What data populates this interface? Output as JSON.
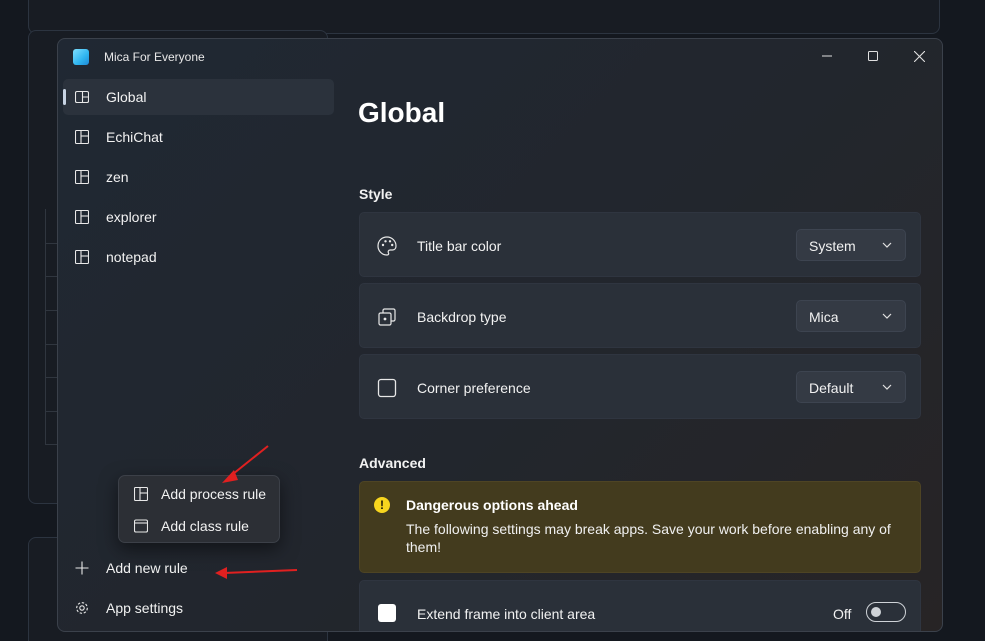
{
  "window": {
    "title": "Mica For Everyone"
  },
  "sidebar": {
    "items": [
      {
        "label": "Global",
        "icon": "global-rule-icon",
        "selected": true
      },
      {
        "label": "EchiChat",
        "icon": "process-rule-icon"
      },
      {
        "label": "zen",
        "icon": "process-rule-icon"
      },
      {
        "label": "explorer",
        "icon": "process-rule-icon"
      },
      {
        "label": "notepad",
        "icon": "process-rule-icon"
      }
    ],
    "add_rule_label": "Add new rule",
    "settings_label": "App settings"
  },
  "flyout": {
    "items": [
      {
        "label": "Add process rule",
        "icon": "process-rule-icon"
      },
      {
        "label": "Add class rule",
        "icon": "window-class-icon"
      }
    ]
  },
  "content": {
    "page_title": "Global",
    "style_section": "Style",
    "settings": [
      {
        "label": "Title bar color",
        "icon": "palette-icon",
        "value": "System"
      },
      {
        "label": "Backdrop type",
        "icon": "backdrop-icon",
        "value": "Mica"
      },
      {
        "label": "Corner preference",
        "icon": "corner-icon",
        "value": "Default"
      }
    ],
    "advanced_section": "Advanced",
    "warning": {
      "title": "Dangerous options ahead",
      "text": "The following settings may break apps. Save your work before enabling any of them!",
      "icon": "!"
    },
    "extend_frame": {
      "label": "Extend frame into client area",
      "state": "Off",
      "on": false
    }
  },
  "colors": {
    "warning_bg": "#433b1e",
    "warning_icon": "#f7d51e",
    "annotation_arrow": "#e02020"
  }
}
